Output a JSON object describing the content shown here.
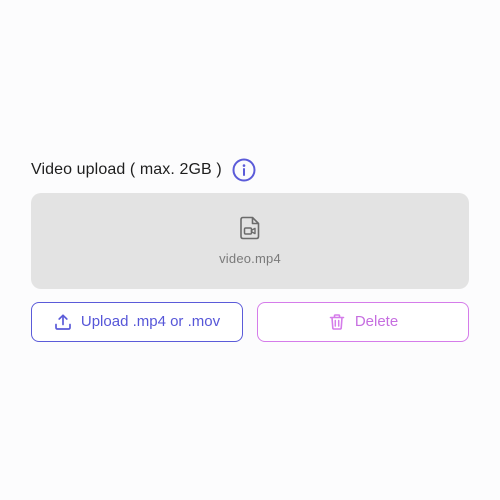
{
  "upload_panel": {
    "title": "Video upload ( max. 2GB )",
    "info_icon": "info-icon",
    "file": {
      "icon": "video-file-icon",
      "name": "video.mp4"
    },
    "upload_button": {
      "icon": "upload-icon",
      "label": "Upload .mp4 or .mov"
    },
    "delete_button": {
      "icon": "trash-icon",
      "label": "Delete"
    }
  },
  "colors": {
    "accent": "#5b5bd9",
    "danger_accent": "#d57cea",
    "dropzone_bg": "#e3e3e3",
    "title_text": "#1e1e1e",
    "muted_text": "#7a7a7a"
  }
}
